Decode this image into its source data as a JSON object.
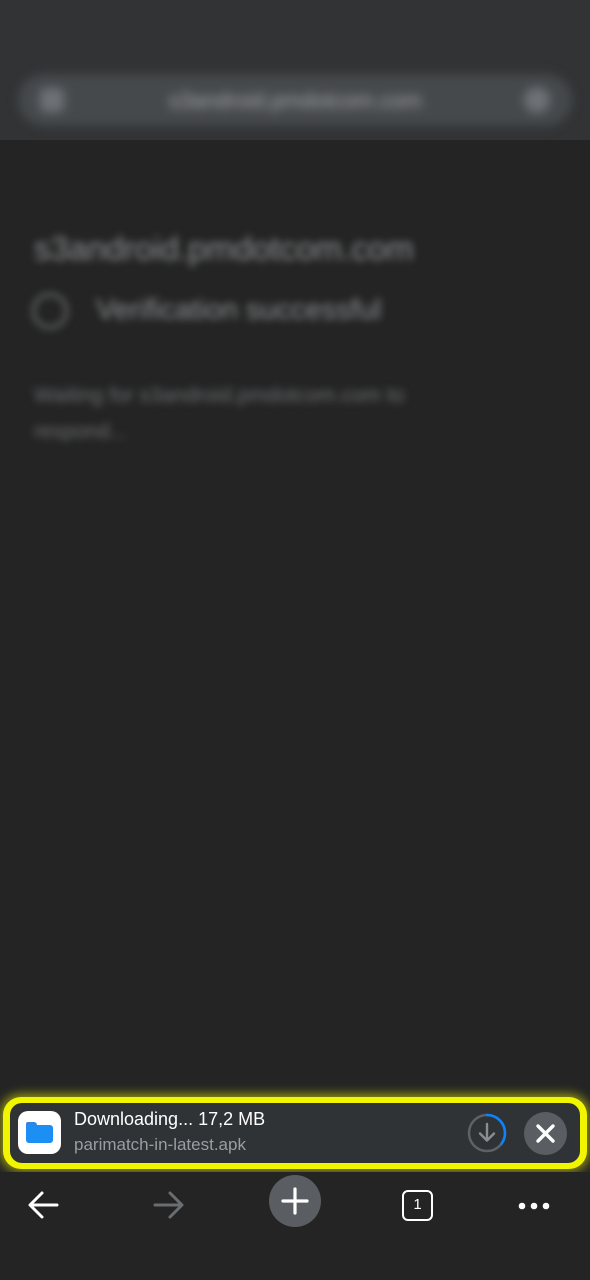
{
  "top_bar": {
    "url": "s3android.pmdotcom.com"
  },
  "page": {
    "site_host": "s3android.pmdotcom.com",
    "verification_text": "Verification successful",
    "waiting_text": "Waiting for s3android.pmdotcom.com to respond..."
  },
  "download": {
    "status": "Downloading... 17,2 MB",
    "filename": "parimatch-in-latest.apk",
    "progress_fraction": 0.35,
    "app_icon": "files-folder-icon",
    "accent_color": "#0a84ff",
    "highlight_color": "#f1f500"
  },
  "toolbar": {
    "tab_count": "1",
    "icons": [
      "back-arrow-icon",
      "forward-arrow-icon",
      "plus-icon",
      "tabs-icon",
      "more-icon"
    ]
  }
}
